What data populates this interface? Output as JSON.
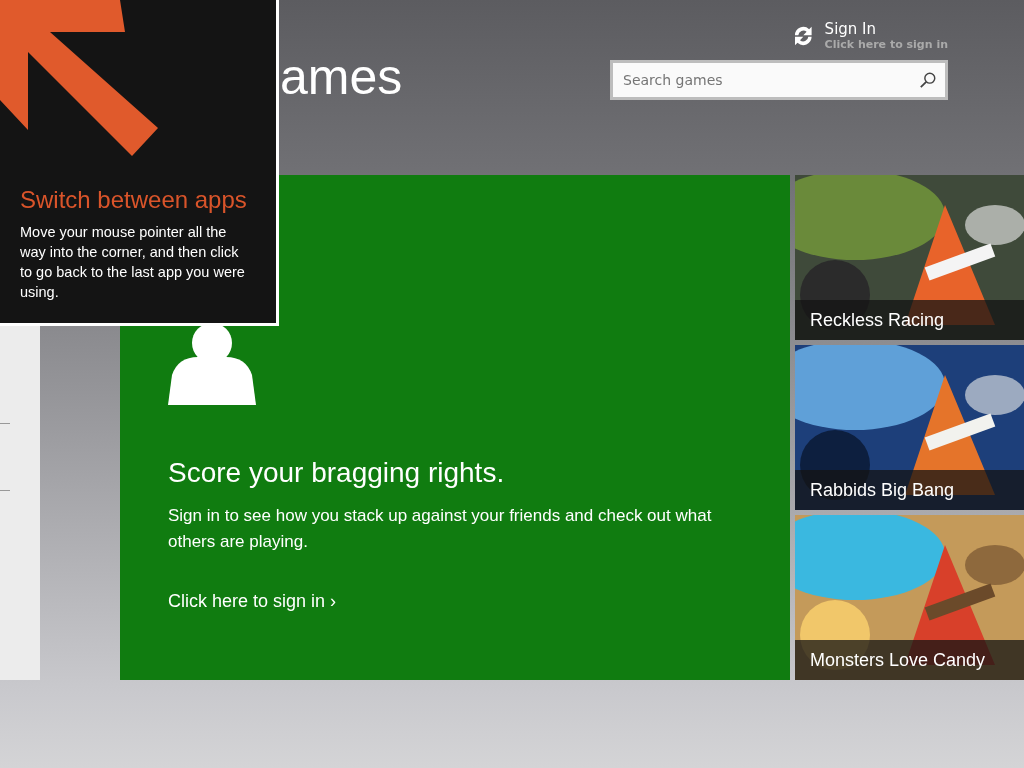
{
  "header": {
    "title": "ames",
    "search": {
      "placeholder": "Search games"
    },
    "sign_in": {
      "title": "Sign In",
      "subtitle": "Click here to sign in"
    }
  },
  "promo": {
    "headline": "Score your bragging rights.",
    "body": "Sign in to see how you stack up against your friends and check out what others are playing.",
    "link": "Click here to sign in ›"
  },
  "tiles": [
    {
      "title": "Reckless Racing",
      "kind": "picture"
    },
    {
      "title": "Rabbids Big Bang",
      "kind": "picture"
    },
    {
      "title": "Monsters Love Candy",
      "kind": "picture"
    }
  ],
  "tip": {
    "title": "Switch between apps",
    "body": "Move your mouse pointer all the way into the corner, and then click to go back to the last app you were using."
  }
}
